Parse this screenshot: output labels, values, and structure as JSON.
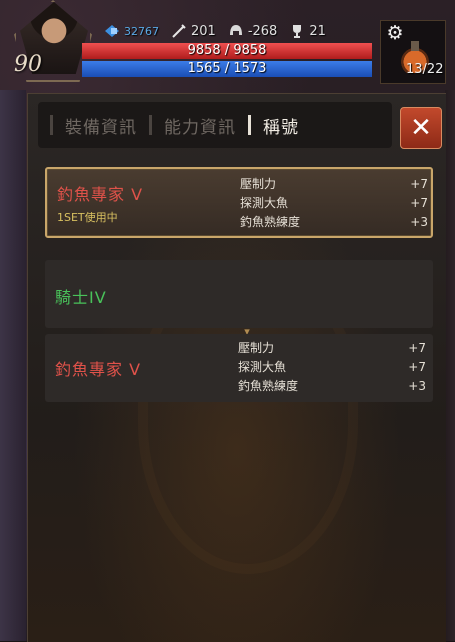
{
  "hud": {
    "level": "90",
    "crystal": "32767",
    "attack": "201",
    "defense": "-268",
    "trophy": "21",
    "hp_text": "9858 / 9858",
    "hp_fill": 1.0,
    "mp_text": "1565 / 1573",
    "mp_fill": 0.995,
    "potion_count": "13/22",
    "colors": {
      "hp": "#d83030",
      "mp": "#2a62d0"
    }
  },
  "tabs": [
    {
      "label": "裝備資訊",
      "active": false
    },
    {
      "label": "能力資訊",
      "active": false
    },
    {
      "label": "稱號",
      "active": true
    }
  ],
  "titles": [
    {
      "name": "釣魚專家 V",
      "status": "1SET使用中",
      "selected": true,
      "stats": [
        {
          "label": "壓制力",
          "value": "+7"
        },
        {
          "label": "探測大魚",
          "value": "+7"
        },
        {
          "label": "釣魚熟練度",
          "value": "+3"
        }
      ]
    },
    {
      "name": "騎士IV"
    },
    {
      "name": "釣魚專家 V",
      "stats": [
        {
          "label": "壓制力",
          "value": "+7"
        },
        {
          "label": "探測大魚",
          "value": "+7"
        },
        {
          "label": "釣魚熟練度",
          "value": "+3"
        }
      ]
    }
  ]
}
